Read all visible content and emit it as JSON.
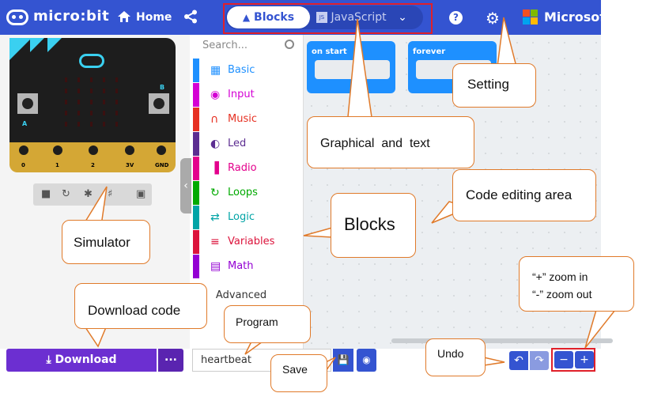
{
  "header": {
    "app_name": "micro:bit",
    "home_label": "Home",
    "blocks_tab": "Blocks",
    "js_tab": "JavaScript",
    "brand": "Microsoft",
    "colors": {
      "bar": "#3454d1",
      "highlight": "#e0202a"
    }
  },
  "simulator": {
    "pin_labels": [
      "0",
      "1",
      "2",
      "3V",
      "GND"
    ],
    "button_a": "A",
    "button_b": "B"
  },
  "toolbox": {
    "search_placeholder": "Search...",
    "categories": [
      {
        "label": "Basic",
        "color": "#1e90ff",
        "icon": "grid-icon"
      },
      {
        "label": "Input",
        "color": "#d400d4",
        "icon": "target-icon"
      },
      {
        "label": "Music",
        "color": "#e63022",
        "icon": "headphones-icon"
      },
      {
        "label": "Led",
        "color": "#5c2d91",
        "icon": "toggle-icon"
      },
      {
        "label": "Radio",
        "color": "#e3008c",
        "icon": "signal-icon"
      },
      {
        "label": "Loops",
        "color": "#00aa00",
        "icon": "loop-icon"
      },
      {
        "label": "Logic",
        "color": "#00a4a6",
        "icon": "shuffle-icon"
      },
      {
        "label": "Variables",
        "color": "#dc143c",
        "icon": "lines-icon"
      },
      {
        "label": "Math",
        "color": "#9400d3",
        "icon": "calculator-icon"
      }
    ],
    "advanced_label": "Advanced"
  },
  "workspace": {
    "blocks": [
      "on start",
      "forever"
    ]
  },
  "bottom": {
    "download_label": "Download",
    "more_label": "...",
    "project_name": "heartbeat"
  },
  "callouts": {
    "setting": "Setting",
    "graphical": "Graphical  and  text",
    "code_area": "Code editing area",
    "blocks": "Blocks",
    "simulator": "Simulator",
    "download": "Download code",
    "program": "Program",
    "save": "Save",
    "undo": "Undo",
    "zoom_in": "“+” zoom in",
    "zoom_out": "“-” zoom out"
  }
}
